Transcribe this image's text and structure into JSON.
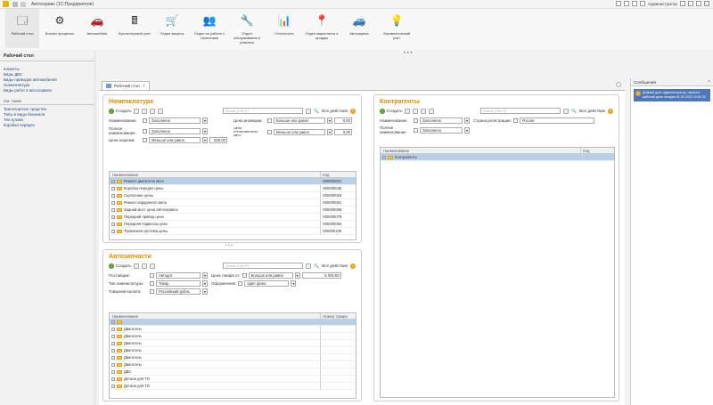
{
  "window": {
    "title": "Автосервис (1С:Предприятие)",
    "user": "Администратор",
    "brand_color": "#e8b400"
  },
  "ribbon": [
    {
      "label": "Рабочий стол",
      "icon": "desktop-icon"
    },
    {
      "label": "Бизнес процессы",
      "icon": "business-process-icon"
    },
    {
      "label": "Автомобили",
      "icon": "car-icon"
    },
    {
      "label": "Бухгалтерский учет",
      "icon": "accounting-icon"
    },
    {
      "label": "Отдел закупок",
      "icon": "purchasing-icon"
    },
    {
      "label": "Отдел по работе с клиентами",
      "icon": "clients-icon"
    },
    {
      "label": "Отдел обслуживания и ремонта",
      "icon": "service-icon"
    },
    {
      "label": "Отчетность",
      "icon": "reports-icon"
    },
    {
      "label": "Отдел маркетинга и продаж",
      "icon": "marketing-icon"
    },
    {
      "label": "Автосервис",
      "icon": "autoservice-icon"
    },
    {
      "label": "Управленческий учет",
      "icon": "management-icon"
    }
  ],
  "nav": {
    "heading": "Рабочий стол",
    "items": [
      "Клиенты",
      "Виды ДВС",
      "Виды приводов автомобилей",
      "Номенклатура",
      "Виды работ в автосервисе"
    ],
    "see_also": "См. также",
    "more": [
      "Транспортное средство",
      "Типы и виды бензинов",
      "Тип кузова",
      "Коробка передач"
    ]
  },
  "tab": {
    "label": "Рабочий стол"
  },
  "common": {
    "create": "Создать",
    "search_placeholder": "Поиск (Ctrl+F)",
    "all_actions": "Все действия",
    "filled": "Заполнено"
  },
  "nomenclature": {
    "title": "Номенклатура",
    "f_name": "Наименование:",
    "f_fullname": "Полное наименование:",
    "f_price_mark": "Цена наценки:",
    "f_price_qty": "Цена отечественного авто:",
    "f_price_foreign": "Цена иномарки:",
    "cmp_more": "Больше или равно",
    "cmp_less": "Меньше или равно",
    "v1": "0,00",
    "v2": "0,00",
    "v3": "500,00",
    "col_name": "Наименование",
    "col_code": "Код",
    "rows": [
      {
        "name": "Ремонт двигателя авто",
        "code": "000000001"
      },
      {
        "name": "Коробка передач цены",
        "code": "000000036"
      },
      {
        "name": "Сцепление цены",
        "code": "000000053"
      },
      {
        "name": "Ремонт карданного вала",
        "code": "000000061"
      },
      {
        "name": "Задний мост цена автосервиса",
        "code": "000000066"
      },
      {
        "name": "Передний привод цена",
        "code": "000000078"
      },
      {
        "name": "Передняя подвеска цена",
        "code": "000000084"
      },
      {
        "name": "Тормозная система цены",
        "code": "000000100"
      }
    ]
  },
  "counterparties": {
    "title": "Контрагенты",
    "f_name": "Наименование:",
    "f_fullname": "Полное наименование:",
    "f_country": "Страна регистрации:",
    "country": "Россия",
    "col_name": "Наименование",
    "col_code": "Код",
    "rows": [
      {
        "name": "Контрагенты"
      }
    ]
  },
  "parts": {
    "title": "Автозапчасти",
    "f_supplier": "Поставщик:",
    "supplier": "Автодот",
    "f_price_from": "Цена товара от:",
    "cmp": "Больше или равно",
    "price": "5 000,00",
    "f_type": "Тип номенклатуры:",
    "type": "Товар",
    "f_finish": "Оформление:",
    "finish": "Цвет фона",
    "f_currency": "Товарная валюта:",
    "currency": "Российский рубль",
    "col_name": "Наименование",
    "col_part": "Номер товара",
    "rows": [
      "Двигатель",
      "Двигатель",
      "Двигатель",
      "Двигатель",
      "Двигатель",
      "Двигатель",
      "ДВС",
      "Детали для ТО",
      "Детали для ТО"
    ]
  },
  "messages": {
    "title": "Сообщения",
    "text": "Добрый день администратор, начался рабочий день сегодня 01.02.2022 15:52:43"
  }
}
